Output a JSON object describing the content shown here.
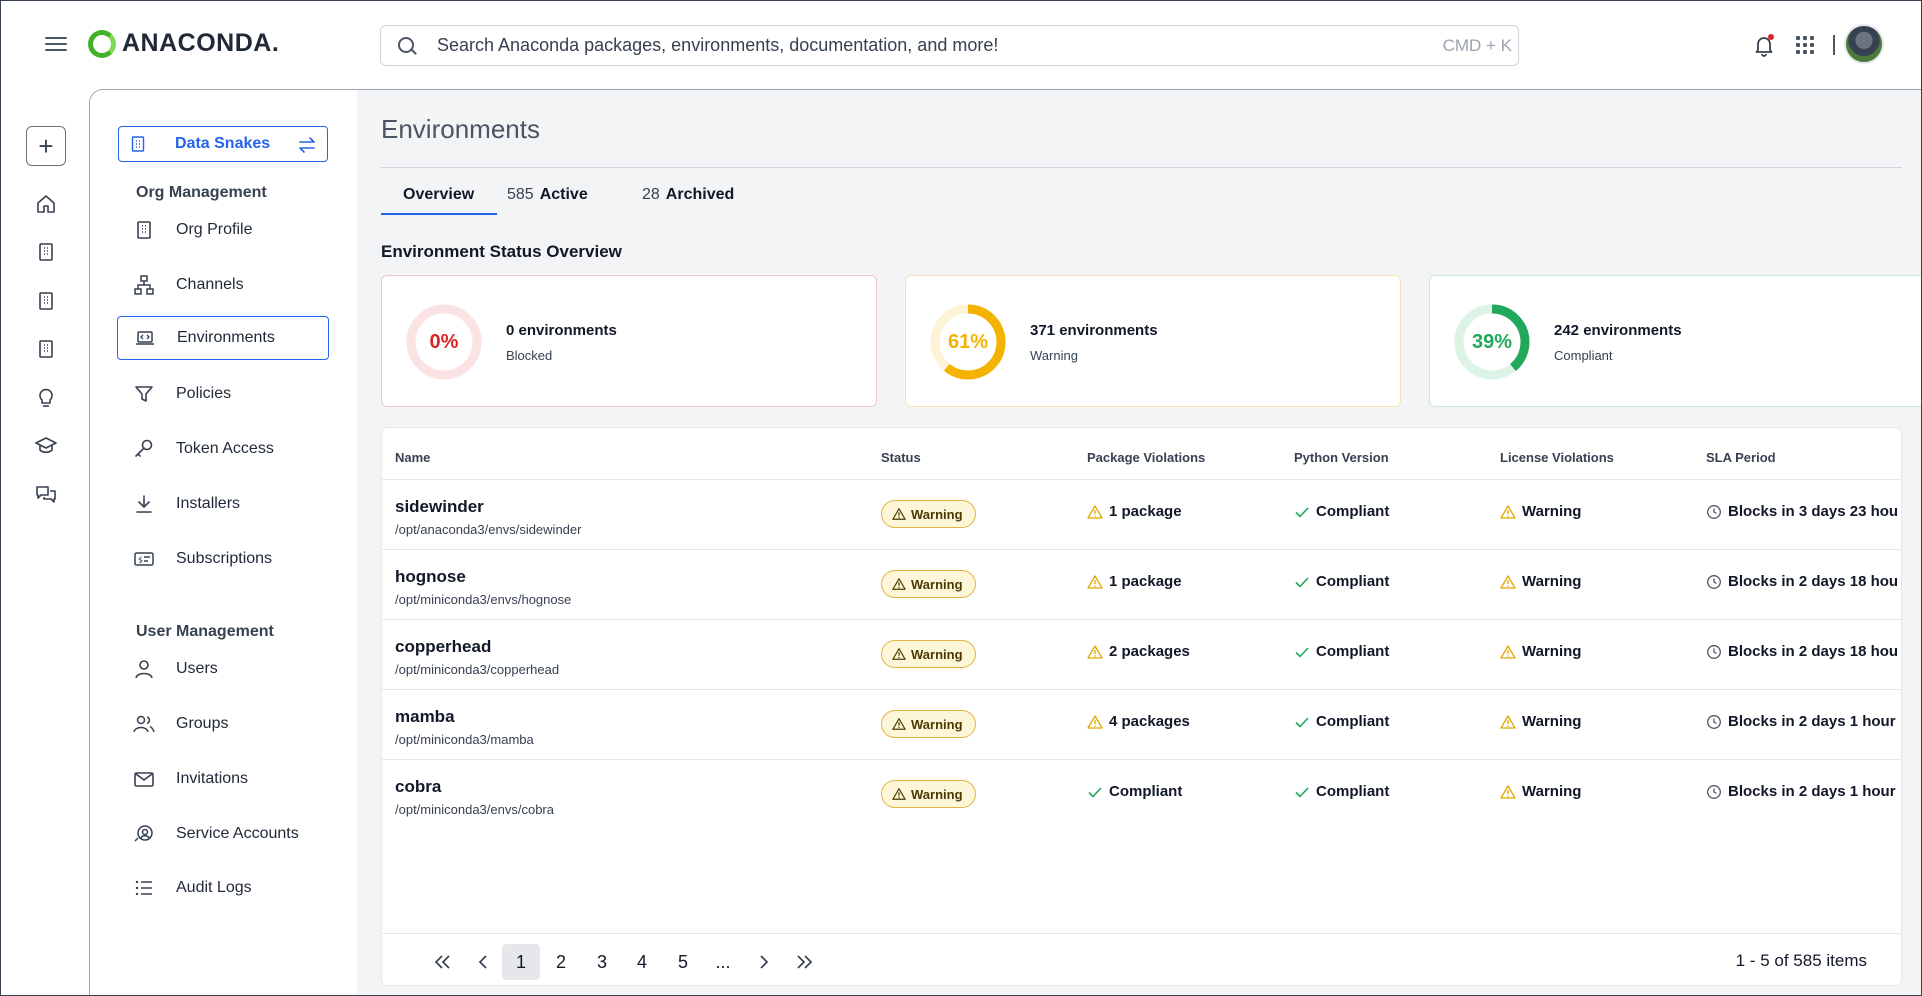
{
  "header": {
    "logo_text": "ANACONDA.",
    "search_placeholder": "Search Anaconda packages, environments, documentation, and more!",
    "search_shortcut": "CMD + K"
  },
  "sidebar": {
    "org_name": "Data Snakes",
    "section_org": "Org Management",
    "section_user": "User Management",
    "org_items": [
      {
        "label": "Org Profile"
      },
      {
        "label": "Channels"
      },
      {
        "label": "Environments"
      },
      {
        "label": "Policies"
      },
      {
        "label": "Token Access"
      },
      {
        "label": "Installers"
      },
      {
        "label": "Subscriptions"
      }
    ],
    "user_items": [
      {
        "label": "Users"
      },
      {
        "label": "Groups"
      },
      {
        "label": "Invitations"
      },
      {
        "label": "Service Accounts"
      },
      {
        "label": "Audit Logs"
      }
    ],
    "active_item": "Environments"
  },
  "main": {
    "title": "Environments",
    "tabs": [
      {
        "count": "",
        "label": "Overview"
      },
      {
        "count": "585",
        "label": "Active"
      },
      {
        "count": "28",
        "label": "Archived"
      }
    ],
    "active_tab": "Overview",
    "overview_title": "Environment Status Overview",
    "cards": [
      {
        "percent_label": "0%",
        "percent": 0,
        "count": "0 environments",
        "status": "Blocked",
        "color": "#dc2626",
        "track": "#fbe3e3",
        "border": "#f4c6c6"
      },
      {
        "percent_label": "61%",
        "percent": 61,
        "count": "371 environments",
        "status": "Warning",
        "color": "#f5b301",
        "track": "#fdf3d6",
        "border": "#f6e3b0"
      },
      {
        "percent_label": "39%",
        "percent": 39,
        "count": "242 environments",
        "status": "Compliant",
        "color": "#22a85a",
        "track": "#dcf3e5",
        "border": "#c6ead5"
      }
    ],
    "table": {
      "headers": [
        "Name",
        "Status",
        "Package Violations",
        "Python Version",
        "License Violations",
        "SLA Period"
      ],
      "rows": [
        {
          "name": "sidewinder",
          "path": "/opt/anaconda3/envs/sidewinder",
          "status": "Warning",
          "pkg": "1 package",
          "pkg_state": "warning",
          "python": "Compliant",
          "license": "Warning",
          "sla": "Blocks in 3 days 23 hou"
        },
        {
          "name": "hognose",
          "path": "/opt/miniconda3/envs/hognose",
          "status": "Warning",
          "pkg": "1 package",
          "pkg_state": "warning",
          "python": "Compliant",
          "license": "Warning",
          "sla": "Blocks in 2 days 18 hou"
        },
        {
          "name": "copperhead",
          "path": "/opt/miniconda3/copperhead",
          "status": "Warning",
          "pkg": "2 packages",
          "pkg_state": "warning",
          "python": "Compliant",
          "license": "Warning",
          "sla": "Blocks in 2 days 18 hou"
        },
        {
          "name": "mamba",
          "path": "/opt/miniconda3/mamba",
          "status": "Warning",
          "pkg": "4 packages",
          "pkg_state": "warning",
          "python": "Compliant",
          "license": "Warning",
          "sla": "Blocks in 2 days 1 hour"
        },
        {
          "name": "cobra",
          "path": "/opt/miniconda3/envs/cobra",
          "status": "Warning",
          "pkg": "Compliant",
          "pkg_state": "compliant",
          "python": "Compliant",
          "license": "Warning",
          "sla": "Blocks in 2 days 1 hour"
        }
      ]
    },
    "pagination": {
      "pages": [
        "1",
        "2",
        "3",
        "4",
        "5",
        "..."
      ],
      "current": "1",
      "info": "1 - 5 of 585 items"
    }
  }
}
